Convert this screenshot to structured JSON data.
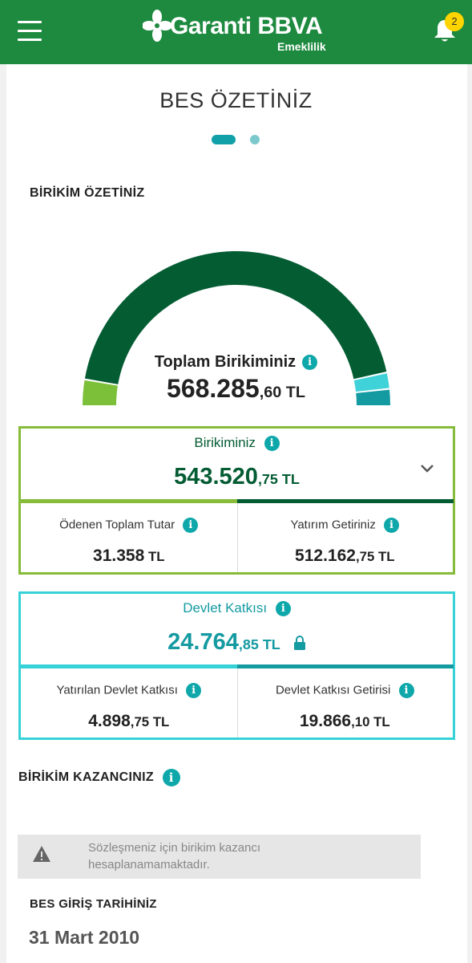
{
  "header": {
    "brand": "Garanti BBVA",
    "sub_brand": "Emeklilik",
    "notification_count": "2",
    "brand_color": "#1d8a3f"
  },
  "page": {
    "title": "BES ÖZETİNİZ",
    "carousel_pages": 2,
    "carousel_active": 1
  },
  "summary": {
    "section_label": "BİRİKİM ÖZETİNİZ",
    "total_label": "Toplam Birikiminiz",
    "total_main": "568.285",
    "total_decimal": ",60 TL",
    "gauge": {
      "segments": [
        {
          "name": "Ödenen Toplam Tutar",
          "value": 31358,
          "color": "#7cc03a"
        },
        {
          "name": "Yatırım Getiriniz",
          "value": 512162.75,
          "color": "#045c33"
        },
        {
          "name": "Yatırılan Devlet Katkısı",
          "value": 4898.75,
          "color": "#3fd2d8"
        },
        {
          "name": "Devlet Katkısı Getirisi",
          "value": 19866.1,
          "color": "#149aa1"
        }
      ]
    }
  },
  "savings": {
    "title": "Birikiminiz",
    "value_main": "543.520",
    "value_decimal": ",75 TL",
    "paid_title": "Ödenen Toplam Tutar",
    "paid_value": "31.358",
    "paid_decimal": " TL",
    "return_title": "Yatırım Getiriniz",
    "return_main": "512.162",
    "return_decimal": ",75 TL"
  },
  "state": {
    "title": "Devlet Katkısı",
    "value_main": "24.764",
    "value_decimal": ",85 TL",
    "invested_title": "Yatırılan Devlet Katkısı",
    "invested_main": "4.898",
    "invested_decimal": ",75 TL",
    "return_title": "Devlet Katkısı Getirisi",
    "return_main": "19.866",
    "return_decimal": ",10 TL"
  },
  "earnings": {
    "section_label": "BİRİKİM KAZANCINIZ",
    "warning": "Sözleşmeniz için birikim kazancı hesaplanamamaktadır."
  },
  "entry": {
    "section_label": "BES GİRİŞ TARİHİNİZ",
    "date": "31 Mart 2010"
  }
}
